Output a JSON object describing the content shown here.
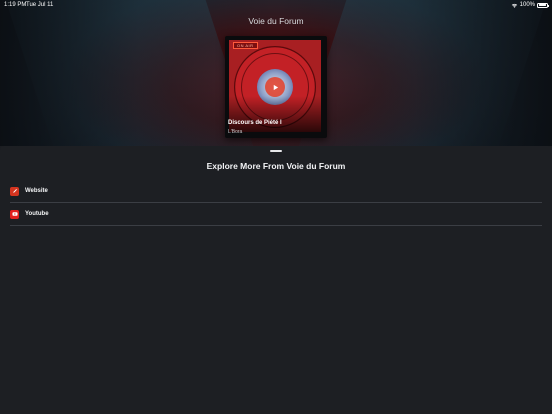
{
  "status_bar": {
    "time": "1:19 PM",
    "date": "Tue Jul 11",
    "battery": "100%",
    "battery_level": 1.0,
    "icons": [
      "wifi-icon",
      "battery-icon"
    ]
  },
  "header": {
    "station_title": "Voie du Forum"
  },
  "now_playing": {
    "badge": "ON AIR",
    "track_title": "Discours de Piété I",
    "artist": "L'Bora",
    "play_icon": "play-icon"
  },
  "sheet": {
    "title": "Explore More From Voie du Forum",
    "links": [
      {
        "label": "Website",
        "icon": "website-icon",
        "icon_color": "#d4341f"
      },
      {
        "label": "Youtube",
        "icon": "youtube-icon",
        "icon_color": "#e0201f"
      }
    ]
  },
  "colors": {
    "accent_red": "#c32126",
    "background": "#1b1d21",
    "sheet_background": "#1d1f23"
  }
}
